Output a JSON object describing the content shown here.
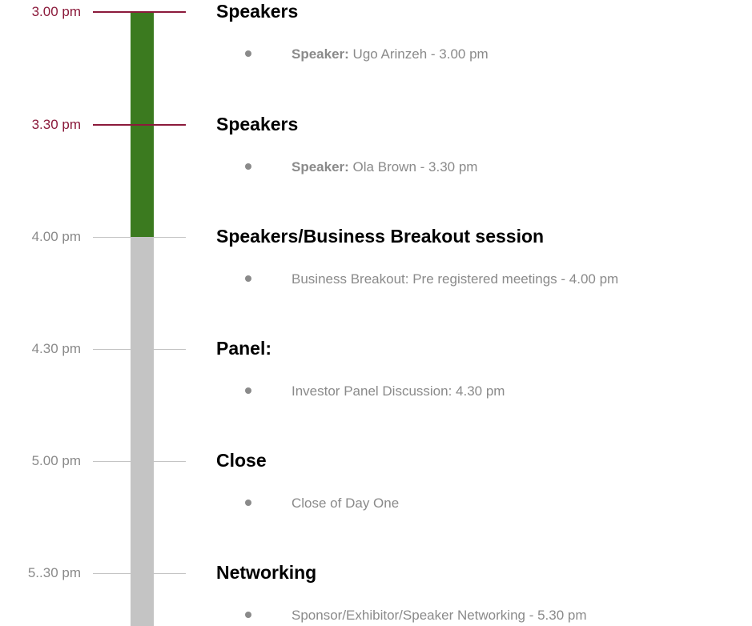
{
  "schedule": [
    {
      "time": "3.00 pm",
      "active": true,
      "title": "Speakers",
      "item_prefix": "Speaker:",
      "item_text": " Ugo Arinzeh - 3.00 pm"
    },
    {
      "time": "3.30 pm",
      "active": true,
      "title": "Speakers",
      "item_prefix": "Speaker:",
      "item_text": " Ola Brown - 3.30 pm"
    },
    {
      "time": "4.00 pm",
      "active": false,
      "title": "Speakers/Business Breakout session",
      "item_prefix": "",
      "item_text": "Business Breakout: Pre registered meetings - 4.00 pm"
    },
    {
      "time": "4.30 pm",
      "active": false,
      "title": "Panel:",
      "item_prefix": "",
      "item_text": "Investor Panel Discussion: 4.30 pm"
    },
    {
      "time": "5.00 pm",
      "active": false,
      "title": "Close",
      "item_prefix": "",
      "item_text": "Close of Day One"
    },
    {
      "time": "5..30 pm",
      "active": false,
      "title": "Networking",
      "item_prefix": "",
      "item_text": "Sponsor/Exhibitor/Speaker Networking - 5.30 pm"
    }
  ],
  "colors": {
    "active_accent": "#8b1a3b",
    "progress_fill": "#3b7a1f",
    "track_rest": "#c4c4c4",
    "muted_text": "#8a8a8a"
  }
}
